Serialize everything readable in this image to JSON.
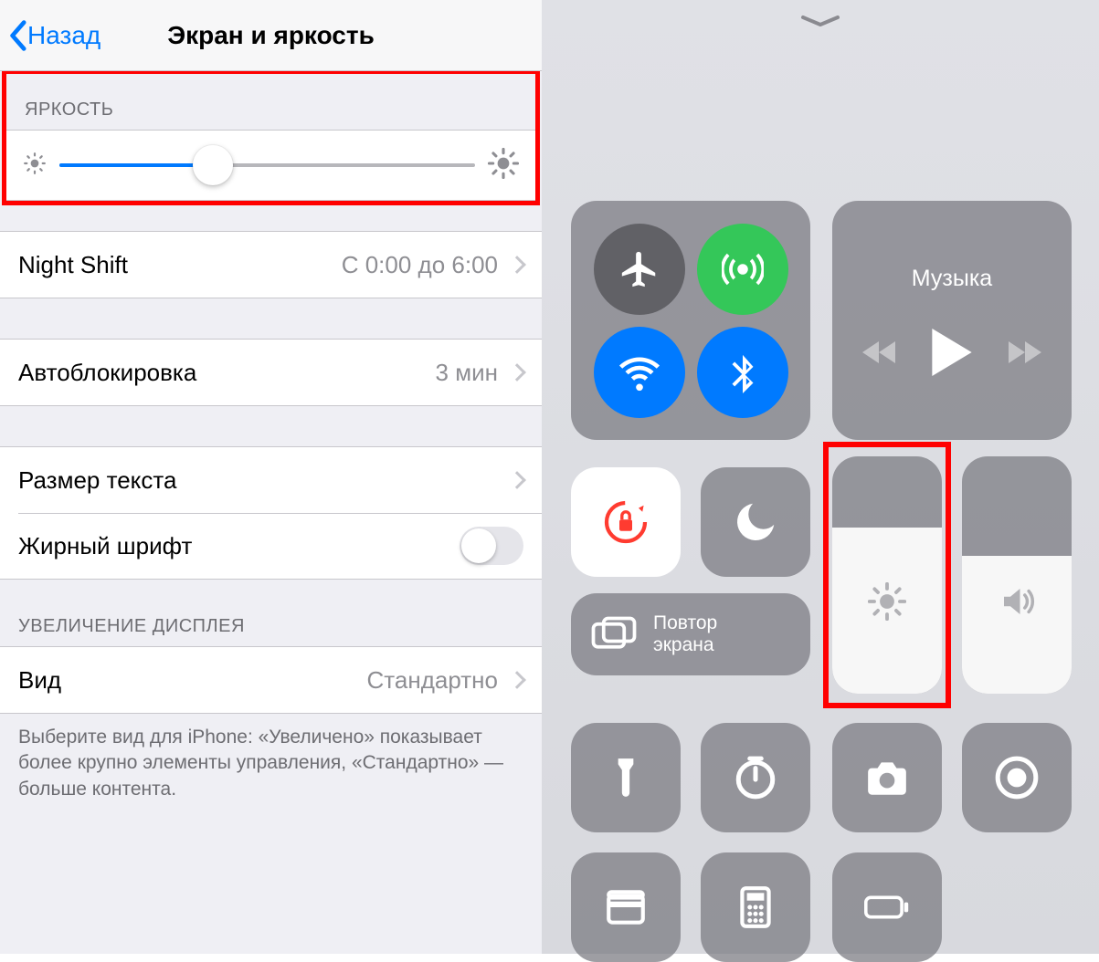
{
  "settings": {
    "back_label": "Назад",
    "title": "Экран и яркость",
    "brightness_header": "ЯРКОСТЬ",
    "brightness_value_pct": 37,
    "night_shift_label": "Night Shift",
    "night_shift_value": "С 0:00 до 6:00",
    "autolock_label": "Автоблокировка",
    "autolock_value": "3 мин",
    "text_size_label": "Размер текста",
    "bold_text_label": "Жирный шрифт",
    "bold_text_on": false,
    "display_zoom_header": "УВЕЛИЧЕНИЕ ДИСПЛЕЯ",
    "view_label": "Вид",
    "view_value": "Стандартно",
    "view_footer": "Выберите вид для iPhone: «Увеличено» показывает более крупно элементы управления, «Стандартно» — больше контента."
  },
  "control_center": {
    "music_label": "Музыка",
    "mirror_line1": "Повтор",
    "mirror_line2": "экрана",
    "brightness_pct": 70,
    "volume_pct": 58,
    "connectivity": {
      "airplane_on": false,
      "cellular_on": true,
      "wifi_on": true,
      "bluetooth_on": true
    }
  }
}
